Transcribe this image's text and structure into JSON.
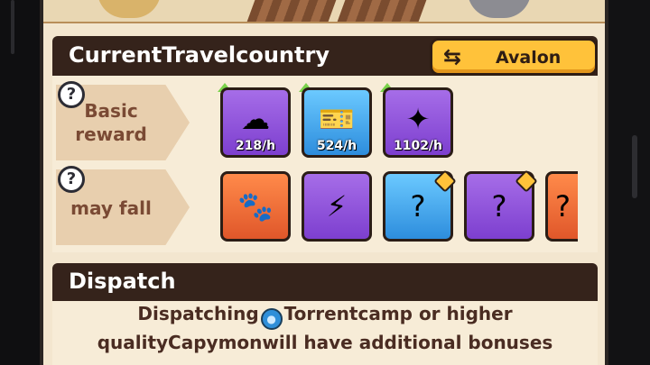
{
  "header": {
    "title": "CurrentTravelcountry",
    "country": "Avalon",
    "swap_icon": "⇆"
  },
  "basic_reward": {
    "help": "?",
    "label_line1": "Basic",
    "label_line2": "reward",
    "items": [
      {
        "icon": "cloud-gold-icon",
        "rate": "218/h",
        "rarity": "purple"
      },
      {
        "icon": "ticket-icon",
        "rate": "524/h",
        "rarity": "blue"
      },
      {
        "icon": "star-card-icon",
        "rate": "1102/h",
        "rarity": "purple"
      }
    ]
  },
  "may_fall": {
    "help": "?",
    "label": "may fall",
    "items": [
      {
        "icon": "paw-coin-icon",
        "rarity": "orange"
      },
      {
        "icon": "canister-icon",
        "rarity": "purple"
      },
      {
        "icon": "mystery-chest-icon",
        "rarity": "blue"
      },
      {
        "icon": "mystery-chest-icon",
        "rarity": "purple"
      },
      {
        "icon": "mystery-chest-icon",
        "rarity": "orange"
      }
    ]
  },
  "dispatch": {
    "title": "Dispatch",
    "line1_before": "Dispatching",
    "line1_after": "Torrentcamp or higher",
    "line2": "qualityCapymonwill have additional bonuses",
    "drop_icon": "water-drop-icon"
  },
  "colors": {
    "header_bg": "#35231b",
    "accent_yellow": "#ffc23a",
    "panel_bg": "#f7ecd7",
    "label_text": "#7a4a34"
  }
}
